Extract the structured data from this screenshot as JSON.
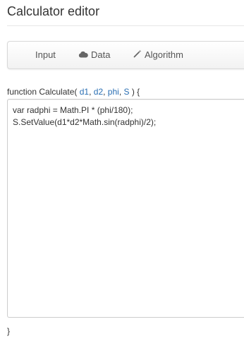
{
  "page": {
    "title": "Calculator editor"
  },
  "tabs": [
    {
      "label": "Input",
      "icon": "none"
    },
    {
      "label": "Data",
      "icon": "cloud-icon"
    },
    {
      "label": "Algorithm",
      "icon": "magic-wand-icon"
    }
  ],
  "function": {
    "prefix": "function Calculate( ",
    "params": [
      "d1",
      "d2",
      "phi",
      "S"
    ],
    "separator": ", ",
    "suffix": " ) {",
    "body": "var radphi = Math.PI * (phi/180);\nS.SetValue(d1*d2*Math.sin(radphi)/2);",
    "close": "}"
  },
  "colors": {
    "param": "#2a6fb3",
    "text": "#333333"
  }
}
